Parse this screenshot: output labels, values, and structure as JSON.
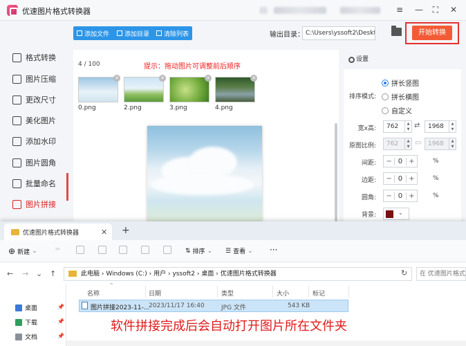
{
  "app": {
    "title": "优速图片格式转换器",
    "window_controls": [
      "—",
      "≡",
      "—",
      "⛶",
      "✕"
    ]
  },
  "sidebar": {
    "items": [
      {
        "label": "格式转换",
        "icon": "format-convert-icon"
      },
      {
        "label": "图片压缩",
        "icon": "compress-icon"
      },
      {
        "label": "更改尺寸",
        "icon": "resize-icon"
      },
      {
        "label": "美化图片",
        "icon": "beautify-icon"
      },
      {
        "label": "添加水印",
        "icon": "watermark-icon"
      },
      {
        "label": "图片圆角",
        "icon": "rounded-corner-icon"
      },
      {
        "label": "批量命名",
        "icon": "rename-icon"
      },
      {
        "label": "图片拼接",
        "icon": "stitch-icon"
      }
    ],
    "active": "图片拼接"
  },
  "toolbar": {
    "add_file": "添加文件",
    "add_folder": "添加目录",
    "clear_list": "清除列表",
    "output_label": "输出目录：",
    "output_path": "C:\\Users\\yssoft2\\Deskt",
    "start": "开始转换"
  },
  "files": {
    "count": "4 / 100",
    "hint": "提示：拖动图片可调整前后顺序",
    "thumbs": [
      "0.png",
      "2.png",
      "3.png",
      "4.png"
    ]
  },
  "settings": {
    "title": "设置",
    "mode_label": "排序模式:",
    "modes": [
      "拼长竖图",
      "拼长横图",
      "自定义"
    ],
    "mode_selected": "拼长竖图",
    "wh_label": "宽x高:",
    "width": "762",
    "height": "1968",
    "ratio_label": "原图比例:",
    "ratio_w": "762",
    "ratio_h": "1968",
    "spacing_label": "间距:",
    "spacing": "0",
    "margin_label": "边距:",
    "margin": "0",
    "radius_label": "圆角:",
    "radius": "0",
    "bg_label": "背景:",
    "bg_color": "#7a1010",
    "unit": "%",
    "link_symbol": "⇄",
    "minus": "−",
    "plus": "+"
  },
  "explorer": {
    "tab": "优速图片格式转换器",
    "commands": {
      "new": "新建",
      "sort": "排序",
      "view": "查看",
      "more": "···"
    },
    "address": [
      "此电脑",
      "Windows (C:)",
      "用户",
      "yssoft2",
      "桌面",
      "优速图片格式转换器"
    ],
    "address_sep": "›",
    "search_placeholder": "在 优速图片格式转换",
    "nav": [
      "桌面",
      "下载",
      "文档"
    ],
    "columns": [
      "名称",
      "日期",
      "类型",
      "大小",
      "标记"
    ],
    "file": {
      "name": "图片拼接2023-11-...",
      "date": "2023/11/17 16:40",
      "type": "JPG 文件",
      "size": "543 KB"
    }
  },
  "caption": "软件拼接完成后会自动打开图片所在文件夹"
}
